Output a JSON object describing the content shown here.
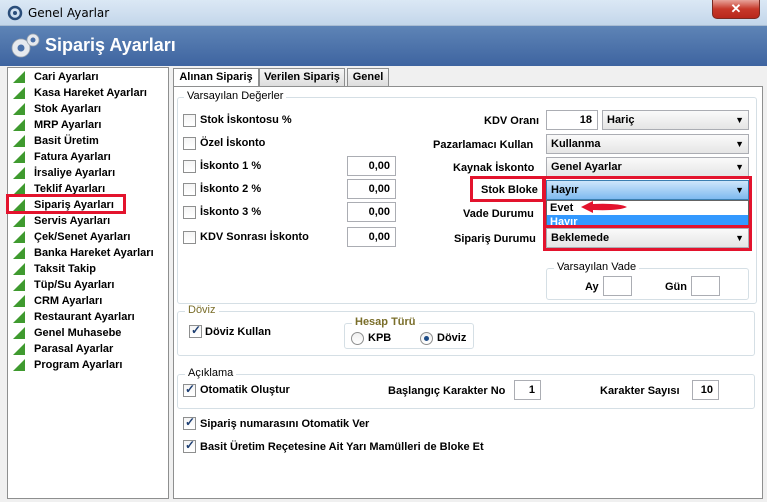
{
  "window": {
    "title": "Genel Ayarlar",
    "close_label": "✕"
  },
  "header": {
    "title": "Sipariş Ayarları"
  },
  "sidebar": {
    "items": [
      {
        "label": "Cari Ayarları"
      },
      {
        "label": "Kasa Hareket Ayarları"
      },
      {
        "label": "Stok Ayarları"
      },
      {
        "label": "MRP Ayarları"
      },
      {
        "label": "Basit Üretim"
      },
      {
        "label": "Fatura Ayarları"
      },
      {
        "label": "İrsaliye Ayarları"
      },
      {
        "label": "Teklif Ayarları"
      },
      {
        "label": "Sipariş Ayarları"
      },
      {
        "label": "Servis Ayarları"
      },
      {
        "label": "Çek/Senet Ayarları"
      },
      {
        "label": "Banka Hareket Ayarları"
      },
      {
        "label": "Taksit Takip"
      },
      {
        "label": "Tüp/Su Ayarları"
      },
      {
        "label": "CRM Ayarları"
      },
      {
        "label": "Restaurant Ayarları"
      },
      {
        "label": "Genel Muhasebe"
      },
      {
        "label": "Parasal Ayarlar"
      },
      {
        "label": "Program Ayarları"
      }
    ],
    "selected": "Sipariş Ayarları"
  },
  "tabs": [
    {
      "label": "Alınan Sipariş",
      "active": true
    },
    {
      "label": "Verilen Sipariş",
      "active": false
    },
    {
      "label": "Genel",
      "active": false
    }
  ],
  "defaults": {
    "title": "Varsayılan Değerler",
    "stok_iskontosu": {
      "label": "Stok İskontosu %",
      "checked": false
    },
    "ozel_iskonto": {
      "label": "Özel İskonto",
      "checked": false
    },
    "iskonto1": {
      "label": "İskonto 1 %",
      "checked": false,
      "value": "0,00"
    },
    "iskonto2": {
      "label": "İskonto 2 %",
      "checked": false,
      "value": "0,00"
    },
    "iskonto3": {
      "label": "İskonto 3 %",
      "checked": false,
      "value": "0,00"
    },
    "kdv_sonrasi": {
      "label": "KDV Sonrası İskonto",
      "checked": false,
      "value": "0,00"
    },
    "kdv_orani": {
      "label": "KDV Oranı",
      "value": "18",
      "mode": "Hariç"
    },
    "pazarlamaci": {
      "label": "Pazarlamacı Kullan",
      "value": "Kullanma"
    },
    "kaynak_iskonto": {
      "label": "Kaynak İskonto",
      "value": "Genel Ayarlar"
    },
    "stok_bloke": {
      "label": "Stok Bloke",
      "value": "Hayır",
      "options": [
        "Evet",
        "Hayır"
      ]
    },
    "vade_durumu": {
      "label": "Vade Durumu"
    },
    "siparis_durumu": {
      "label": "Sipariş Durumu",
      "value": "Beklemede"
    },
    "varsayilan_vade": {
      "title": "Varsayılan Vade",
      "ay_label": "Ay",
      "ay_value": "",
      "gun_label": "Gün",
      "gun_value": ""
    }
  },
  "doviz": {
    "title": "Döviz",
    "doviz_kullan": {
      "label": "Döviz Kullan",
      "checked": true
    },
    "hesap_turu": {
      "title": "Hesap Türü",
      "kpb": "KPB",
      "doviz": "Döviz",
      "selected": "Döviz"
    }
  },
  "aciklama": {
    "title": "Açıklama",
    "otomatik": {
      "label": "Otomatik Oluştur",
      "checked": true
    },
    "baslangic": {
      "label": "Başlangıç Karakter No",
      "value": "1"
    },
    "karakter_sayisi": {
      "label": "Karakter Sayısı",
      "value": "10"
    }
  },
  "options": {
    "siparis_no": {
      "label": "Sipariş numarasını Otomatik Ver",
      "checked": true
    },
    "basit_uretim": {
      "label": "Basit Üretim Reçetesine Ait Yarı Mamülleri de Bloke Et",
      "checked": true
    }
  },
  "colors": {
    "highlight": "#e3132d",
    "selection": "#3399ff",
    "header": "#4a70a8"
  }
}
